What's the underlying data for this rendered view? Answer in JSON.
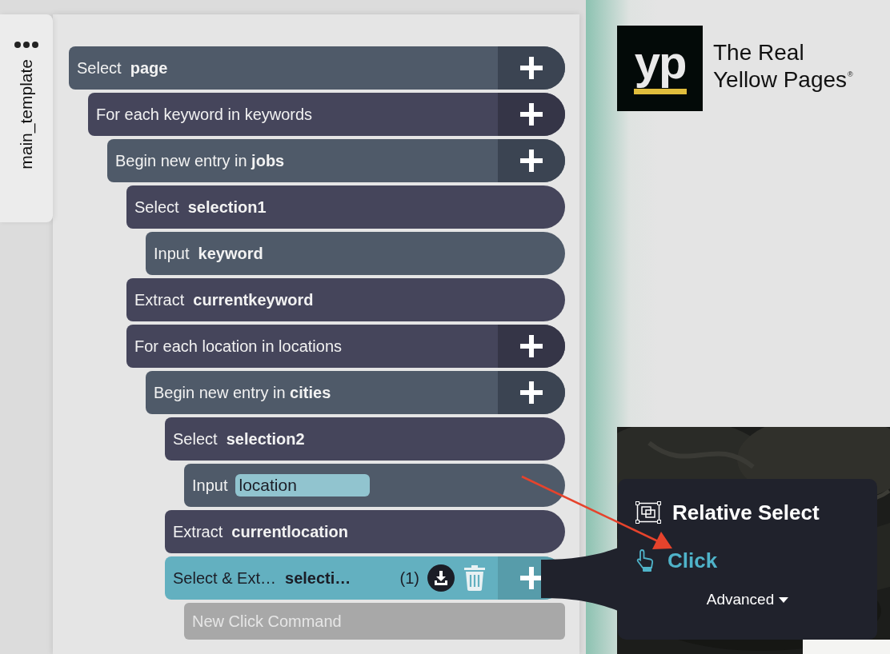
{
  "sidebar": {
    "tab": {
      "label": "main_template"
    }
  },
  "workflow": {
    "commands": [
      {
        "kind": "command",
        "label": "Select  **page**",
        "add_button": true,
        "selected": false,
        "children": [
          {
            "kind": "command",
            "label": "For each keyword in keywords",
            "add_button": true,
            "selected": false,
            "children": [
              {
                "kind": "command",
                "label": "Begin new entry in **jobs**",
                "add_button": true,
                "selected": false,
                "children": [
                  {
                    "kind": "command",
                    "label": "Select  **selection1**",
                    "add_button": false,
                    "selected": false,
                    "children": [
                      {
                        "kind": "command",
                        "label": "Input  **keyword**",
                        "add_button": false,
                        "selected": false
                      }
                    ]
                  },
                  {
                    "kind": "command",
                    "label": "Extract  **currentkeyword**",
                    "add_button": false,
                    "selected": false
                  },
                  {
                    "kind": "command",
                    "label": "For each location in locations",
                    "add_button": true,
                    "selected": false,
                    "children": [
                      {
                        "kind": "command",
                        "label": "Begin new entry in **cities**",
                        "add_button": true,
                        "selected": false,
                        "children": [
                          {
                            "kind": "command",
                            "label": "Select  **selection2**",
                            "add_button": false,
                            "selected": false,
                            "children": [
                              {
                                "kind": "input",
                                "label": "Input",
                                "value": "location",
                                "add_button": false,
                                "selected": false
                              }
                            ]
                          },
                          {
                            "kind": "command",
                            "label": "Extract  **currentlocation**",
                            "add_button": false,
                            "selected": false
                          },
                          {
                            "kind": "command",
                            "label": "Select & Ext…  **selecti…**",
                            "count": "(1)",
                            "add_button": true,
                            "selected": true,
                            "children": [
                              {
                                "kind": "placeholder",
                                "label": "New Click Command"
                              }
                            ]
                          }
                        ]
                      }
                    ]
                  }
                ]
              }
            ]
          }
        ]
      }
    ]
  },
  "preview": {
    "logo": {
      "mark": "yp",
      "lines": [
        "The Real",
        "Yellow Pages"
      ],
      "registered": "®"
    }
  },
  "popup": {
    "items": [
      {
        "label": "Relative Select",
        "kind": "relative",
        "selected": false
      },
      {
        "label": "Click",
        "kind": "click",
        "selected": true
      }
    ],
    "advanced": "Advanced"
  }
}
